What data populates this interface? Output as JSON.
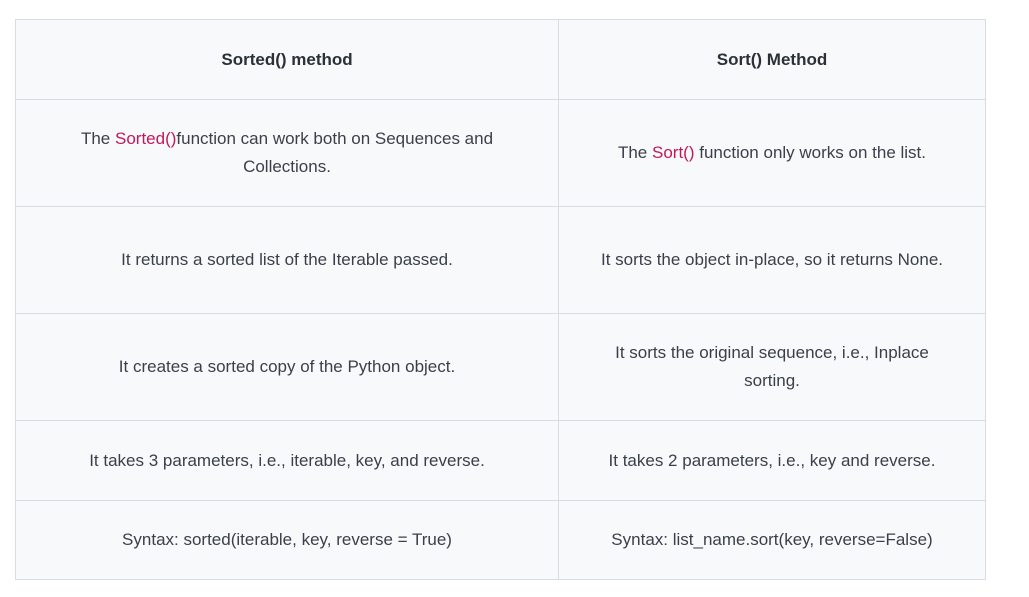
{
  "table": {
    "headers": [
      "Sorted() method",
      "Sort() Method"
    ],
    "rows": [
      {
        "left": {
          "pre": "The ",
          "highlight": "Sorted()",
          "post": "function can work both on Sequences and Collections."
        },
        "right": {
          "pre": "The ",
          "highlight": "Sort()",
          "post": " function only works on the list."
        }
      },
      {
        "left": {
          "text": "It returns a sorted list of the Iterable passed."
        },
        "right": {
          "text": "It sorts the object in-place, so it returns None."
        }
      },
      {
        "left": {
          "text": "It creates a sorted copy of the Python object."
        },
        "right": {
          "text": "It sorts the original sequence, i.e., Inplace sorting."
        }
      },
      {
        "left": {
          "text": "It takes 3 parameters, i.e., iterable, key, and reverse."
        },
        "right": {
          "text": "It takes 2 parameters, i.e., key and reverse."
        }
      },
      {
        "left": {
          "text": "Syntax: sorted(iterable, key, reverse = True)"
        },
        "right": {
          "text": "Syntax: list_name.sort(key, reverse=False)"
        }
      }
    ],
    "highlight_color": "#c2185b"
  }
}
